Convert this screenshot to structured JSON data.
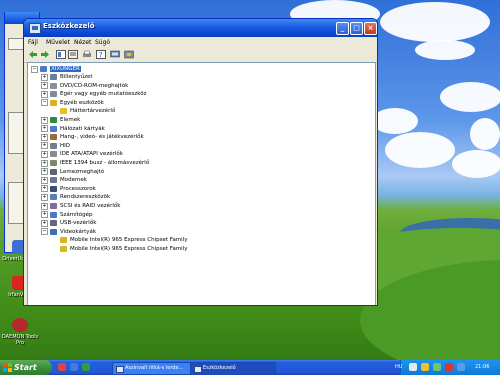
{
  "window": {
    "title": "Eszközkezelő",
    "controls": {
      "minimize": "_",
      "maximize": "□",
      "close": "×"
    }
  },
  "menu": [
    "Fájl",
    "Művelet",
    "Nézet",
    "Súgó"
  ],
  "tree": {
    "root": "XIXUNGER",
    "items": [
      {
        "label": "Billentyűzet",
        "indent": 1,
        "expander": "+",
        "icon": "keyboard-icon",
        "color": "#6b7f99"
      },
      {
        "label": "DVD/CD-ROM-meghajtók",
        "indent": 1,
        "expander": "+",
        "icon": "cdrom-icon",
        "color": "#8a8f99"
      },
      {
        "label": "Egér vagy egyéb mutatóeszköz",
        "indent": 1,
        "expander": "+",
        "icon": "mouse-icon",
        "color": "#7f8a9b"
      },
      {
        "label": "Egyéb eszközök",
        "indent": 1,
        "expander": "−",
        "icon": "unknown-device-icon",
        "color": "#d9b21f"
      },
      {
        "label": "Háttértárvezérlő",
        "indent": 2,
        "expander": "",
        "icon": "warning-icon",
        "color": "#e3c21a"
      },
      {
        "label": "Elemek",
        "indent": 1,
        "expander": "+",
        "icon": "battery-icon",
        "color": "#2f8a3a"
      },
      {
        "label": "Hálózati kártyák",
        "indent": 1,
        "expander": "+",
        "icon": "network-icon",
        "color": "#4a7ac9"
      },
      {
        "label": "Hang-, videó- és játékvezérlők",
        "indent": 1,
        "expander": "+",
        "icon": "sound-icon",
        "color": "#9a6a3a"
      },
      {
        "label": "HID",
        "indent": 1,
        "expander": "+",
        "icon": "hid-icon",
        "color": "#6f7f8f"
      },
      {
        "label": "IDE ATA/ATAPI vezérlők",
        "indent": 1,
        "expander": "+",
        "icon": "ide-icon",
        "color": "#8b8b8b"
      },
      {
        "label": "IEEE 1394 busz - állomásvezérlő",
        "indent": 1,
        "expander": "+",
        "icon": "firewire-icon",
        "color": "#7a8a6a"
      },
      {
        "label": "Lemezmeghajtó",
        "indent": 1,
        "expander": "+",
        "icon": "disk-icon",
        "color": "#5d6470"
      },
      {
        "label": "Modemek",
        "indent": 1,
        "expander": "+",
        "icon": "modem-icon",
        "color": "#6b7590"
      },
      {
        "label": "Processzorok",
        "indent": 1,
        "expander": "+",
        "icon": "processor-icon",
        "color": "#3f4f6f"
      },
      {
        "label": "Rendszereszközök",
        "indent": 1,
        "expander": "+",
        "icon": "system-icon",
        "color": "#5a7fb8"
      },
      {
        "label": "SCSI és RAID vezérlők",
        "indent": 1,
        "expander": "+",
        "icon": "scsi-icon",
        "color": "#7d6f9a"
      },
      {
        "label": "Számítógép",
        "indent": 1,
        "expander": "+",
        "icon": "computer-icon",
        "color": "#4d79c4"
      },
      {
        "label": "USB-vezérlők",
        "indent": 1,
        "expander": "+",
        "icon": "usb-icon",
        "color": "#5c6a7a"
      },
      {
        "label": "Videokártyák",
        "indent": 1,
        "expander": "−",
        "icon": "display-icon",
        "color": "#3a6fb5"
      },
      {
        "label": "Mobile Intel(R) 965 Express Chipset Family",
        "indent": 2,
        "expander": "",
        "icon": "display-adapter-icon",
        "color": "#d8b71e"
      },
      {
        "label": "Mobile Intel(R) 965 Express Chipset Family",
        "indent": 2,
        "expander": "",
        "icon": "display-adapter-icon",
        "color": "#d8b71e"
      }
    ]
  },
  "desktop_icons": [
    {
      "label": "DriverUpdater",
      "icon": "driverupdater-icon"
    },
    {
      "label": "IrfanView",
      "icon": "irfanview-icon"
    },
    {
      "label": "DAEMON Tools Pro",
      "icon": "daemon-tools-icon"
    }
  ],
  "taskbar": {
    "start": "Start",
    "tasks": [
      {
        "label": "Aszinvali ritká-s lerde...",
        "active": false
      },
      {
        "label": "Eszközkezelő",
        "active": true
      }
    ],
    "lang": "HU",
    "clock": "21:06"
  }
}
